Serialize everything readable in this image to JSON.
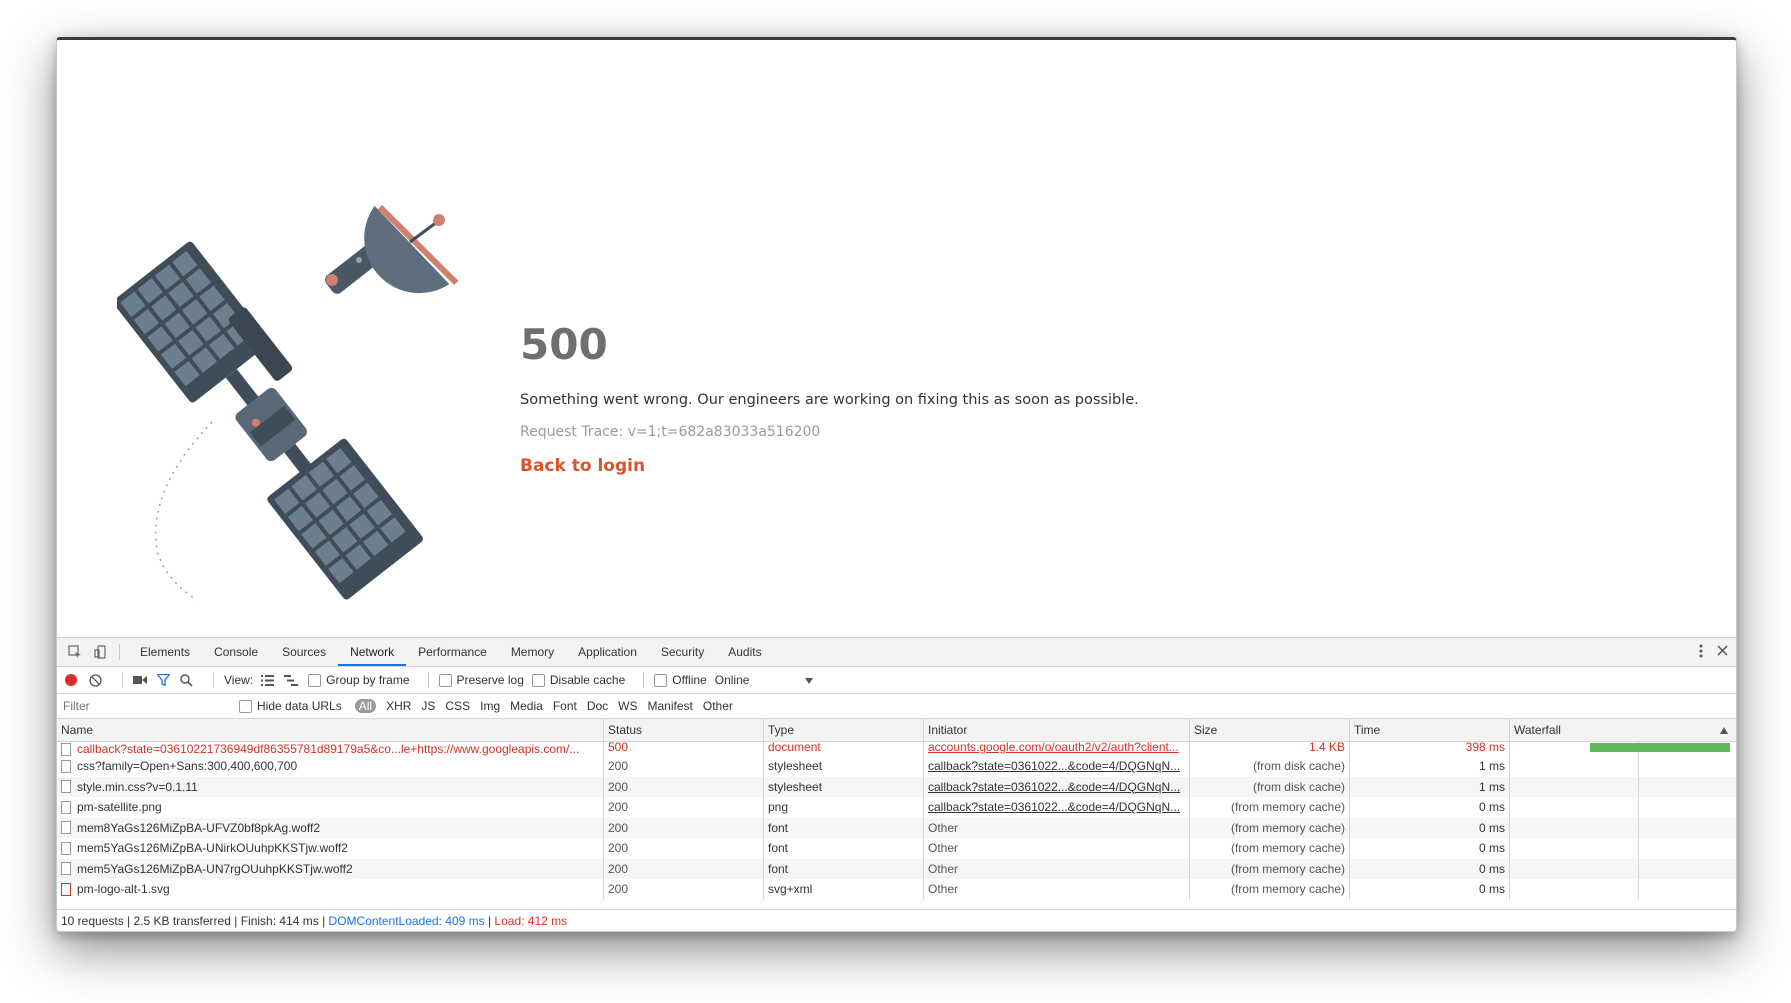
{
  "error_page": {
    "code": "500",
    "message": "Something went wrong. Our engineers are working on fixing this as soon as possible.",
    "trace": "Request Trace: v=1;t=682a83033a516200",
    "back_link": "Back to login"
  },
  "colors": {
    "accent": "#d9542b",
    "satellite_panel": "#5f6e7c",
    "devtools_blue": "#1a73e8",
    "error_red": "#d93025",
    "waterfall_green": "#5cb85c"
  },
  "devtools": {
    "tabs": [
      "Elements",
      "Console",
      "Sources",
      "Network",
      "Performance",
      "Memory",
      "Application",
      "Security",
      "Audits"
    ],
    "active_tab": "Network",
    "toolbar": {
      "view_label": "View:",
      "group_by_frame": "Group by frame",
      "preserve_log": "Preserve log",
      "disable_cache": "Disable cache",
      "offline": "Offline",
      "throttle": "Online"
    },
    "filter": {
      "placeholder": "Filter",
      "hide_data_urls": "Hide data URLs",
      "types": [
        "All",
        "XHR",
        "JS",
        "CSS",
        "Img",
        "Media",
        "Font",
        "Doc",
        "WS",
        "Manifest",
        "Other"
      ]
    },
    "columns": [
      "Name",
      "Status",
      "Type",
      "Initiator",
      "Size",
      "Time",
      "Waterfall"
    ],
    "rows": [
      {
        "name": "callback?state=03610221736949df86355781d89179a5&co...le+https://www.googleapis.com/...",
        "status": "500",
        "type": "document",
        "initiator": "accounts.google.com/o/oauth2/v2/auth?client...",
        "size": "1.4 KB",
        "time": "398 ms"
      },
      {
        "name": "css?family=Open+Sans:300,400,600,700",
        "status": "200",
        "type": "stylesheet",
        "initiator": "callback?state=0361022...&code=4/DQGNqN...",
        "size": "(from disk cache)",
        "time": "1 ms"
      },
      {
        "name": "style.min.css?v=0.1.11",
        "status": "200",
        "type": "stylesheet",
        "initiator": "callback?state=0361022...&code=4/DQGNqN...",
        "size": "(from disk cache)",
        "time": "1 ms"
      },
      {
        "name": "pm-satellite.png",
        "status": "200",
        "type": "png",
        "initiator": "callback?state=0361022...&code=4/DQGNqN...",
        "size": "(from memory cache)",
        "time": "0 ms"
      },
      {
        "name": "mem8YaGs126MiZpBA-UFVZ0bf8pkAg.woff2",
        "status": "200",
        "type": "font",
        "initiator": "Other",
        "size": "(from memory cache)",
        "time": "0 ms"
      },
      {
        "name": "mem5YaGs126MiZpBA-UNirkOUuhpKKSTjw.woff2",
        "status": "200",
        "type": "font",
        "initiator": "Other",
        "size": "(from memory cache)",
        "time": "0 ms"
      },
      {
        "name": "mem5YaGs126MiZpBA-UN7rgOUuhpKKSTjw.woff2",
        "status": "200",
        "type": "font",
        "initiator": "Other",
        "size": "(from memory cache)",
        "time": "0 ms"
      },
      {
        "name": "pm-logo-alt-1.svg",
        "status": "200",
        "type": "svg+xml",
        "initiator": "Other",
        "size": "(from memory cache)",
        "time": "0 ms"
      }
    ],
    "summary": {
      "requests": "10 requests",
      "transferred": "2.5 KB transferred",
      "finish": "Finish: 414 ms",
      "dom_content_loaded": "DOMContentLoaded: 409 ms",
      "load": "Load: 412 ms"
    }
  }
}
